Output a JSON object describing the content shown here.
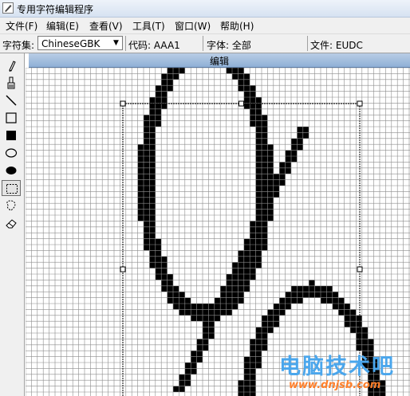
{
  "window": {
    "title": "专用字符编辑程序",
    "icon": "pencil-app-icon"
  },
  "menu": [
    {
      "label": "文件(F)"
    },
    {
      "label": "编辑(E)"
    },
    {
      "label": "查看(V)"
    },
    {
      "label": "工具(T)"
    },
    {
      "label": "窗口(W)"
    },
    {
      "label": "帮助(H)"
    }
  ],
  "infobar": {
    "charset_label": "字符集:",
    "charset_value": "ChineseGBK",
    "code_label": "代码: AAA1",
    "font_label": "字体: 全部",
    "file_label": "文件: EUDC"
  },
  "tools": [
    {
      "name": "pencil-icon"
    },
    {
      "name": "brush-icon"
    },
    {
      "name": "line-icon"
    },
    {
      "name": "hollow-rectangle-icon"
    },
    {
      "name": "filled-rectangle-icon"
    },
    {
      "name": "hollow-ellipse-icon"
    },
    {
      "name": "filled-ellipse-icon"
    },
    {
      "name": "rectangle-select-icon",
      "selected": true
    },
    {
      "name": "freeform-select-icon"
    },
    {
      "name": "eraser-icon"
    }
  ],
  "editor": {
    "title": "编辑",
    "colors": {
      "grid_line": "#8c8c8c",
      "filled_cell": "#000000"
    }
  },
  "watermark": {
    "text": "电脑技术吧",
    "url": "www.dnjsb.com"
  }
}
